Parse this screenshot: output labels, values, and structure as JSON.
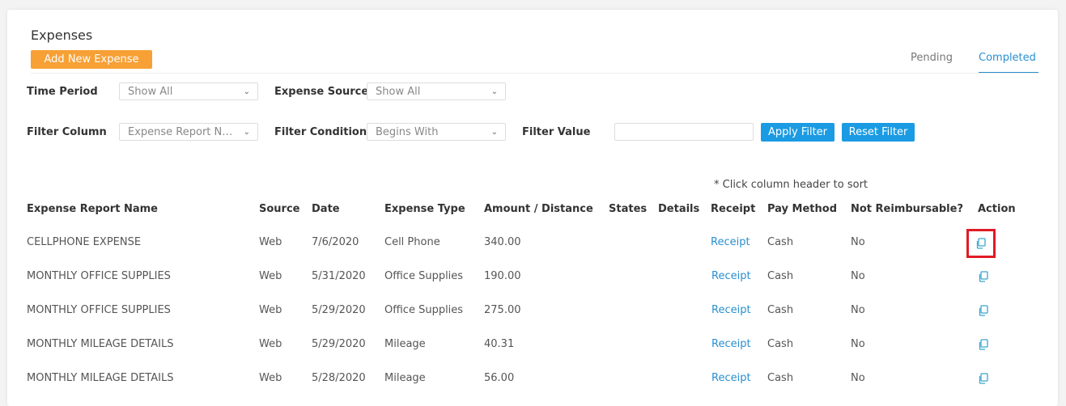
{
  "header": {
    "title": "Expenses",
    "add_button": "Add New Expense"
  },
  "tabs": [
    {
      "label": "Pending",
      "active": false
    },
    {
      "label": "Completed",
      "active": true
    }
  ],
  "filters": {
    "time_period": {
      "label": "Time Period",
      "value": "Show All"
    },
    "expense_source": {
      "label": "Expense Source",
      "value": "Show All"
    },
    "filter_column": {
      "label": "Filter Column",
      "value": "Expense Report Na..."
    },
    "filter_condition": {
      "label": "Filter Condition",
      "value": "Begins With"
    },
    "filter_value": {
      "label": "Filter Value",
      "value": ""
    },
    "apply_button": "Apply Filter",
    "reset_button": "Reset Filter"
  },
  "sort_note": "* Click column header to sort",
  "table": {
    "headers": [
      "Expense Report Name",
      "Source",
      "Date",
      "Expense Type",
      "Amount / Distance",
      "States",
      "Details",
      "Receipt",
      "Pay Method",
      "Not Reimbursable?",
      "Action"
    ],
    "rows": [
      {
        "name": "CELLPHONE EXPENSE",
        "source": "Web",
        "date": "7/6/2020",
        "type": "Cell Phone",
        "amount": "340.00",
        "states": "",
        "details": "",
        "receipt": "Receipt",
        "pay_method": "Cash",
        "not_reimbursable": "No",
        "action_icon": "copy-icon"
      },
      {
        "name": "MONTHLY OFFICE SUPPLIES",
        "source": "Web",
        "date": "5/31/2020",
        "type": "Office Supplies",
        "amount": "190.00",
        "states": "",
        "details": "",
        "receipt": "Receipt",
        "pay_method": "Cash",
        "not_reimbursable": "No",
        "action_icon": "copy-icon"
      },
      {
        "name": "MONTHLY OFFICE SUPPLIES",
        "source": "Web",
        "date": "5/29/2020",
        "type": "Office Supplies",
        "amount": "275.00",
        "states": "",
        "details": "",
        "receipt": "Receipt",
        "pay_method": "Cash",
        "not_reimbursable": "No",
        "action_icon": "copy-icon"
      },
      {
        "name": "MONTHLY MILEAGE DETAILS",
        "source": "Web",
        "date": "5/29/2020",
        "type": "Mileage",
        "amount": "40.31",
        "states": "",
        "details": "",
        "receipt": "Receipt",
        "pay_method": "Cash",
        "not_reimbursable": "No",
        "action_icon": "copy-icon"
      },
      {
        "name": "MONTHLY MILEAGE DETAILS",
        "source": "Web",
        "date": "5/28/2020",
        "type": "Mileage",
        "amount": "56.00",
        "states": "",
        "details": "",
        "receipt": "Receipt",
        "pay_method": "Cash",
        "not_reimbursable": "No",
        "action_icon": "copy-icon"
      }
    ]
  },
  "colors": {
    "accent_orange": "#f7a035",
    "accent_blue": "#1a9be3",
    "link_blue": "#2a8fcf",
    "action_icon": "#3aa6cc",
    "highlight_red": "#e01b24"
  }
}
